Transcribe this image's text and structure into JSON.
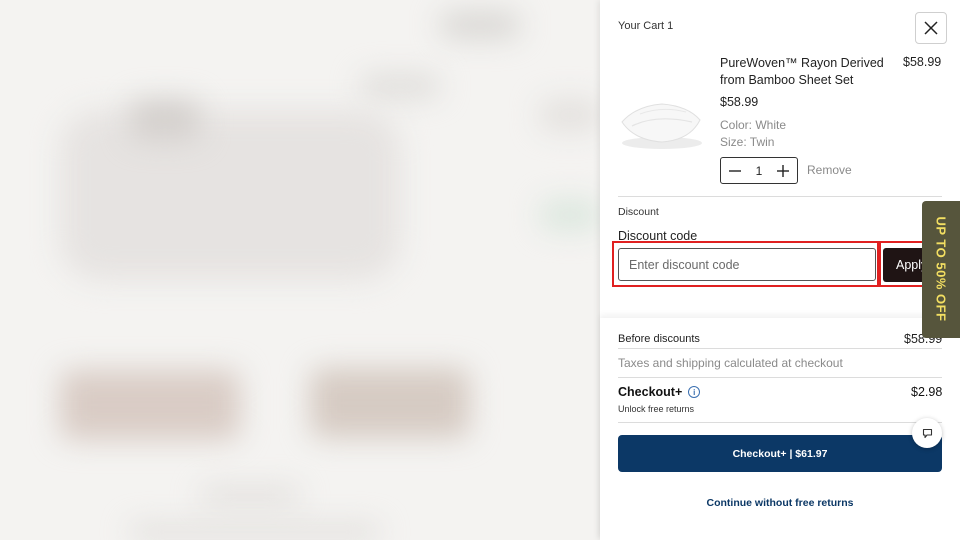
{
  "cart": {
    "title": "Your Cart 1",
    "close_icon": "close-icon",
    "item": {
      "name": "PureWoven™ Rayon Derived from Bamboo Sheet Set",
      "price_right": "$58.99",
      "price": "$58.99",
      "color": "Color: White",
      "size": "Size: Twin",
      "quantity": "1",
      "remove_label": "Remove"
    }
  },
  "discount": {
    "title": "Discount",
    "label": "Discount code",
    "placeholder": "Enter discount code",
    "value": "",
    "apply_label": "Apply"
  },
  "summary": {
    "before_label": "Before discounts",
    "before_value": "$58.99",
    "tax_note": "Taxes and shipping calculated at checkout",
    "checkout_plus_label": "Checkout+",
    "checkout_plus_price": "$2.98",
    "unlock_note": "Unlock free returns",
    "checkout_button": "Checkout+ | $61.97",
    "continue_link": "Continue without free returns"
  },
  "promo": {
    "label": "UP TO 50% OFF"
  },
  "colors": {
    "checkout_blue": "#0c3866",
    "apply_dark": "#1f1414",
    "promo_bg": "#56553c",
    "promo_text": "#f3df62",
    "highlight_red": "#e02020"
  },
  "icons": [
    "close-icon",
    "minus-icon",
    "plus-icon",
    "info-icon",
    "chat-icon"
  ]
}
